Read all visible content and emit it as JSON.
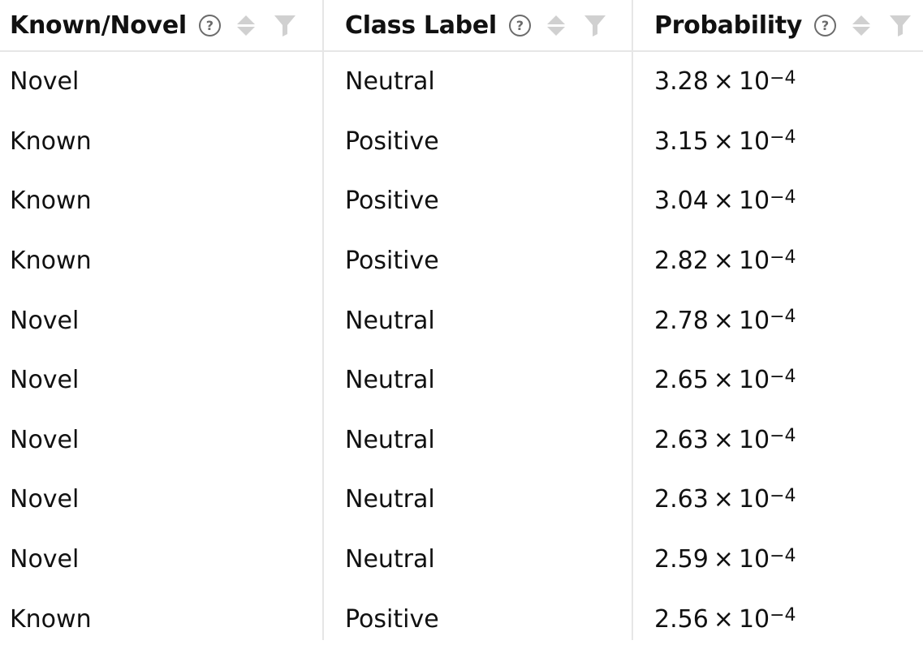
{
  "columns": [
    {
      "title": "Known/Novel",
      "help": "?"
    },
    {
      "title": "Class Label",
      "help": "?"
    },
    {
      "title": "Probability",
      "help": "?"
    }
  ],
  "rows": [
    {
      "known_novel": "Novel",
      "class_label": "Neutral",
      "prob_mantissa": "3.28",
      "prob_times": "×",
      "prob_base": "10",
      "prob_exp": "−4"
    },
    {
      "known_novel": "Known",
      "class_label": "Positive",
      "prob_mantissa": "3.15",
      "prob_times": "×",
      "prob_base": "10",
      "prob_exp": "−4"
    },
    {
      "known_novel": "Known",
      "class_label": "Positive",
      "prob_mantissa": "3.04",
      "prob_times": "×",
      "prob_base": "10",
      "prob_exp": "−4"
    },
    {
      "known_novel": "Known",
      "class_label": "Positive",
      "prob_mantissa": "2.82",
      "prob_times": "×",
      "prob_base": "10",
      "prob_exp": "−4"
    },
    {
      "known_novel": "Novel",
      "class_label": "Neutral",
      "prob_mantissa": "2.78",
      "prob_times": "×",
      "prob_base": "10",
      "prob_exp": "−4"
    },
    {
      "known_novel": "Novel",
      "class_label": "Neutral",
      "prob_mantissa": "2.65",
      "prob_times": "×",
      "prob_base": "10",
      "prob_exp": "−4"
    },
    {
      "known_novel": "Novel",
      "class_label": "Neutral",
      "prob_mantissa": "2.63",
      "prob_times": "×",
      "prob_base": "10",
      "prob_exp": "−4"
    },
    {
      "known_novel": "Novel",
      "class_label": "Neutral",
      "prob_mantissa": "2.63",
      "prob_times": "×",
      "prob_base": "10",
      "prob_exp": "−4"
    },
    {
      "known_novel": "Novel",
      "class_label": "Neutral",
      "prob_mantissa": "2.59",
      "prob_times": "×",
      "prob_base": "10",
      "prob_exp": "−4"
    },
    {
      "known_novel": "Known",
      "class_label": "Positive",
      "prob_mantissa": "2.56",
      "prob_times": "×",
      "prob_base": "10",
      "prob_exp": "−4"
    }
  ],
  "icons": {
    "help": "help-circle-icon",
    "sort": "sort-icon",
    "filter": "filter-icon"
  },
  "colors": {
    "text": "#111111",
    "icon_dark": "#6b6b6b",
    "icon_light": "#d0d0d0",
    "border": "#e6e6e6",
    "background": "#ffffff"
  }
}
